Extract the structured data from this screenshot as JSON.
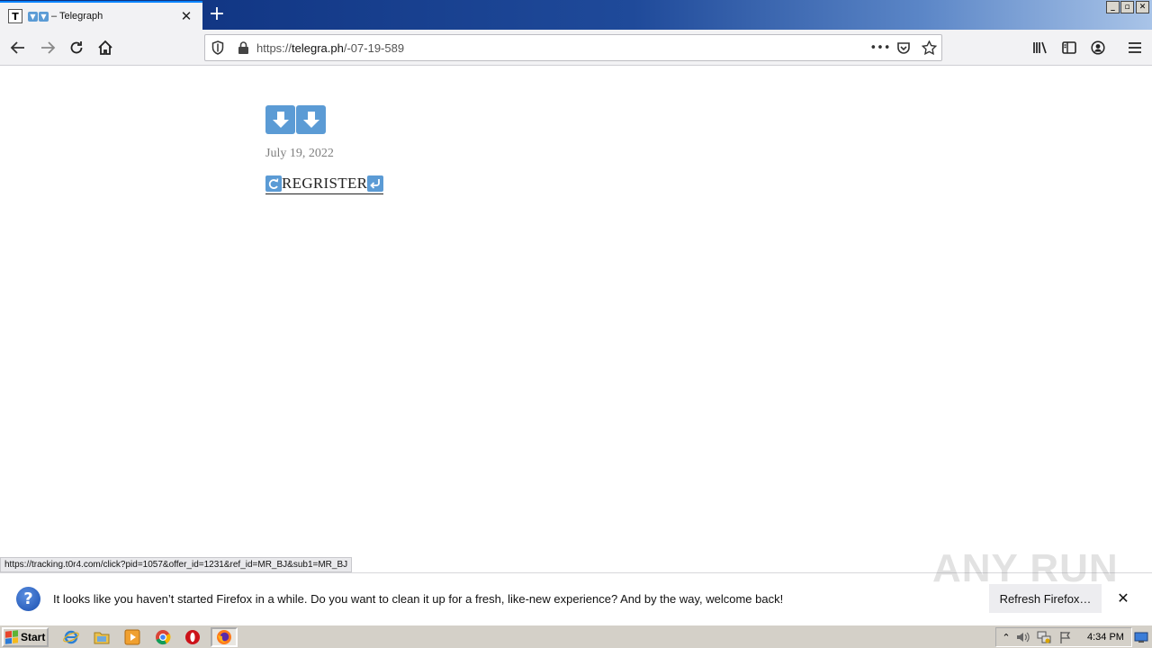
{
  "browser": {
    "tab": {
      "favicon_letter": "T",
      "title_suffix": "– Telegraph",
      "close_glyph": "✕"
    },
    "new_tab_glyph": "+",
    "window_controls": {
      "minimize": "_",
      "restore": "▫",
      "close": "✕"
    },
    "url": {
      "prefix": "https://",
      "host": "telegra.ph",
      "path": "/-07-19-589"
    },
    "urlbar_more_glyph": "•••"
  },
  "page": {
    "date": "July 19, 2022",
    "link_text": "REGRISTER"
  },
  "status_link": "https://tracking.t0r4.com/click?pid=1057&offer_id=1231&ref_id=MR_BJ&sub1=MR_BJ",
  "notification": {
    "icon_glyph": "?",
    "message": "It looks like you haven’t started Firefox in a while. Do you want to clean it up for a fresh, like-new experience? And by the way, welcome back!",
    "button_label": "Refresh Firefox…",
    "close_glyph": "✕"
  },
  "watermark": "ANY RUN",
  "taskbar": {
    "start_label": "Start",
    "clock": "4:34 PM"
  },
  "colors": {
    "accent_blue": "#5b9bd5",
    "tab_accent": "#0a84ff"
  }
}
